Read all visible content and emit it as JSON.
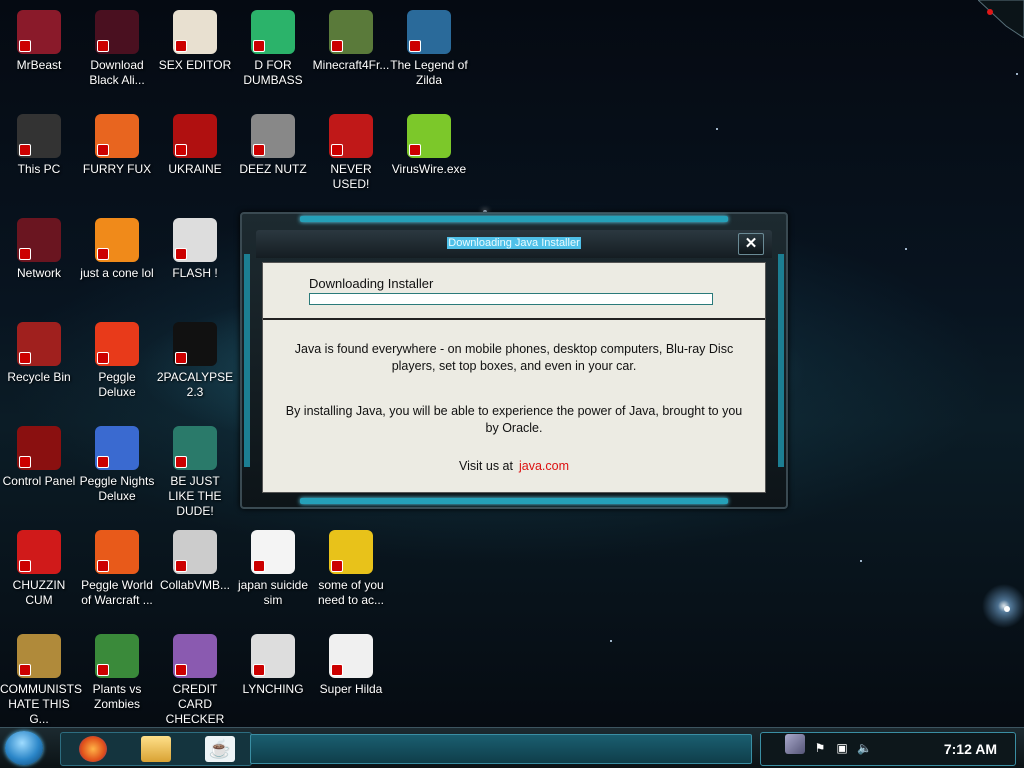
{
  "desktop": {
    "icons": [
      {
        "label": "MrBeast",
        "icon": "mrbeast-icon"
      },
      {
        "label": "Download Black Ali...",
        "icon": "orb-icon"
      },
      {
        "label": "SEX EDITOR",
        "icon": "hex-editor-icon"
      },
      {
        "label": "D FOR DUMBASS",
        "icon": "chat-bubble-icon"
      },
      {
        "label": "Minecraft4Fr...",
        "icon": "grass-block-icon"
      },
      {
        "label": "The Legend of Zilda",
        "icon": "zelda-character-icon"
      },
      {
        "label": "This PC",
        "icon": "computer-icon"
      },
      {
        "label": "FURRY FUX",
        "icon": "firefox-icon"
      },
      {
        "label": "UKRAINE",
        "icon": "radiation-icon"
      },
      {
        "label": "DEEZ NUTZ",
        "icon": "stacked-windows-icon"
      },
      {
        "label": "NEVER USED!",
        "icon": "dev-cpp-icon"
      },
      {
        "label": "VirusWire.exe",
        "icon": "limewire-icon"
      },
      {
        "label": "Network",
        "icon": "network-orb-icon"
      },
      {
        "label": "just a cone lol",
        "icon": "vlc-cone-icon"
      },
      {
        "label": "FLASH !",
        "icon": "flash-icon"
      },
      {
        "label": "Recycle Bin",
        "icon": "recycle-bin-icon"
      },
      {
        "label": "Peggle Deluxe",
        "icon": "peggle-icon"
      },
      {
        "label": "2PACALYPSE 2.3",
        "icon": "terminal-icon"
      },
      {
        "label": "Control Panel",
        "icon": "control-panel-icon"
      },
      {
        "label": "Peggle Nights Deluxe",
        "icon": "peggle-nights-icon"
      },
      {
        "label": "BE JUST LIKE THE DUDE!",
        "icon": "santa-icon"
      },
      {
        "label": "CHUZZIN CUM",
        "icon": "chuzzle-icon"
      },
      {
        "label": "Peggle World of Warcraft ...",
        "icon": "peggle-wow-icon"
      },
      {
        "label": "CollabVMB...",
        "icon": "collabvm-icon"
      },
      {
        "label": "japan suicide sim",
        "icon": "document-icon"
      },
      {
        "label": "some of you need to ac...",
        "icon": "dog-icon"
      },
      {
        "label": "COMMUNISTS HATE THIS G...",
        "icon": "money-bag-icon"
      },
      {
        "label": "Plants vs Zombies",
        "icon": "pvz-icon"
      },
      {
        "label": "CREDIT CARD CHECKER",
        "icon": "credit-card-icon"
      },
      {
        "label": "LYNCHING",
        "icon": "noose-icon"
      },
      {
        "label": "Super Hilda",
        "icon": "pixel-character-icon"
      }
    ]
  },
  "java_window": {
    "title": "Downloading Java Installer",
    "close_label": "✕",
    "downloading_label": "Downloading Installer",
    "progress": 0.0,
    "message1": "Java is found everywhere - on mobile phones, desktop computers, Blu-ray Disc players, set top boxes, and even in your car.",
    "message2": "By installing Java, you will be able to experience the power of Java, brought to you by Oracle.",
    "visit_text": "Visit us at",
    "visit_link": "java.com"
  },
  "taskbar": {
    "clock": "7:12 AM",
    "pinned": [
      "firefox-icon",
      "file-explorer-icon",
      "java-icon"
    ],
    "tray": [
      "search-icon",
      "flag-icon",
      "network-icon",
      "volume-icon"
    ]
  },
  "colors": {
    "accent": "#25a0b8",
    "progress_border": "#2a7a7a",
    "link": "#d11111",
    "window_bg": "#ecebe3"
  }
}
